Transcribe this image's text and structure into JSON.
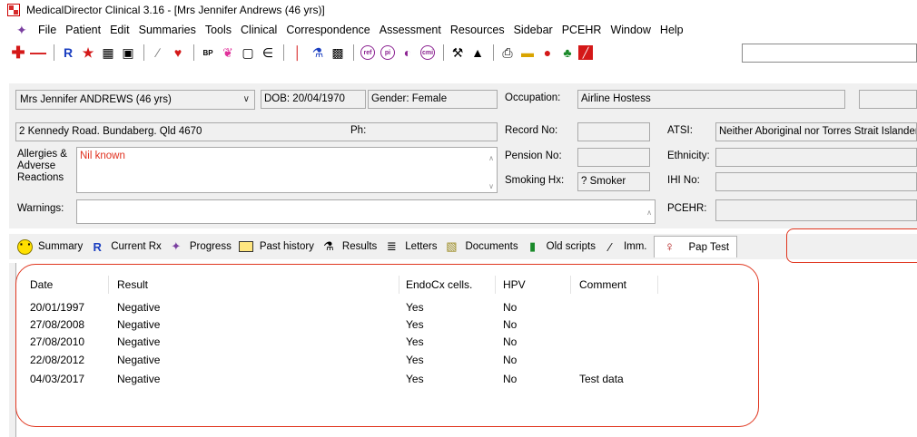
{
  "window": {
    "title": "MedicalDirector Clinical 3.16 - [Mrs Jennifer Andrews (46 yrs)]"
  },
  "menu": [
    "File",
    "Patient",
    "Edit",
    "Summaries",
    "Tools",
    "Clinical",
    "Correspondence",
    "Assessment",
    "Resources",
    "Sidebar",
    "PCEHR",
    "Window",
    "Help"
  ],
  "toolbar": {
    "icons": [
      "add-patient-icon",
      "remove-icon",
      "prescription-icon",
      "run-icon",
      "scan-icon",
      "notes-icon",
      "pen-icon",
      "heart-icon",
      "blood-pressure-icon",
      "lungs-icon",
      "clipboard-icon",
      "hearing-icon",
      "thermometer-icon",
      "pathology-icon",
      "graph-icon",
      "ref-icon",
      "pi-icon",
      "record-icon",
      "cmi-icon",
      "tools-icon",
      "graduate-icon",
      "print-icon",
      "folder-icon",
      "person-icon",
      "tree-icon",
      "chart-icon"
    ],
    "ref_label": "ref",
    "pi_label": "pi",
    "cmi_label": "cmi",
    "search_value": ""
  },
  "patient": {
    "name_combo": "Mrs Jennifer ANDREWS (46 yrs)",
    "dob": "DOB: 20/04/1970",
    "gender": "Gender: Female",
    "occupation_label": "Occupation:",
    "occupation_value": "Airline Hostess",
    "address": "2 Kennedy Road. Bundaberg. Qld  4670",
    "ph_label": "Ph:",
    "record_no_label": "Record No:",
    "atsi_label": "ATSI:",
    "atsi_value": "Neither Aboriginal nor Torres Strait Islander",
    "allergies_label_1": "Allergies &",
    "allergies_label_2": "Adverse",
    "allergies_label_3": "Reactions",
    "allergies_value": "Nil known",
    "pension_no_label": "Pension No:",
    "ethnicity_label": "Ethnicity:",
    "smoking_label": "Smoking Hx:",
    "smoking_value": "? Smoker",
    "ihi_label": "IHI No:",
    "warnings_label": "Warnings:",
    "pcehr_label": "PCEHR:"
  },
  "tabs": [
    {
      "label": "Summary"
    },
    {
      "label": "Current Rx"
    },
    {
      "label": "Progress"
    },
    {
      "label": "Past history"
    },
    {
      "label": "Results"
    },
    {
      "label": "Letters"
    },
    {
      "label": "Documents"
    },
    {
      "label": "Old scripts"
    },
    {
      "label": "Imm."
    },
    {
      "label": "Pap Test"
    }
  ],
  "table": {
    "columns": [
      "Date",
      "Result",
      "EndoCx cells.",
      "HPV",
      "Comment"
    ],
    "rows": [
      [
        "20/01/1997",
        "Negative",
        "Yes",
        "No",
        ""
      ],
      [
        "27/08/2008",
        "Negative",
        "Yes",
        "No",
        ""
      ],
      [
        "27/08/2010",
        "Negative",
        "Yes",
        "No",
        ""
      ],
      [
        "22/08/2012",
        "Negative",
        "Yes",
        "No",
        ""
      ],
      [
        "04/03/2017",
        "Negative",
        "Yes",
        "No",
        "Test data"
      ]
    ]
  },
  "colors": {
    "annotation": "#e0361f",
    "allergy_text": "#e0301e",
    "rx_blue": "#1a3ec0",
    "panel_bg": "#f0f0f0"
  }
}
